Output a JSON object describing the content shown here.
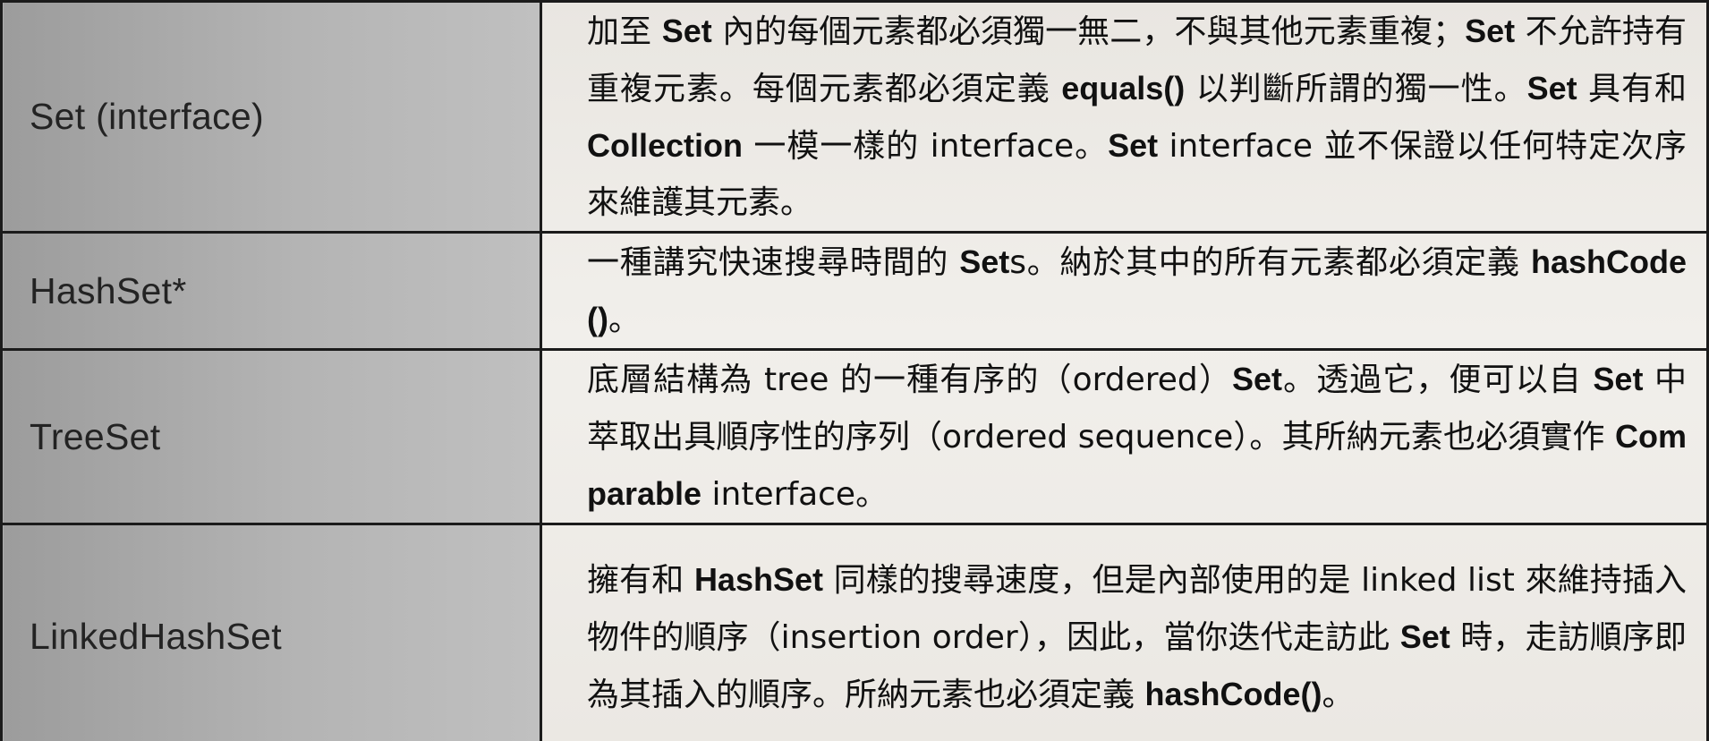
{
  "set_types": [
    {
      "name": "Set (interface)",
      "description": [
        {
          "t": "加至 "
        },
        {
          "t": "Set",
          "b": true
        },
        {
          "t": " 內的每個元素都必須獨一無二，不與其他元素重複；"
        },
        {
          "t": "Set",
          "b": true
        },
        {
          "t": " 不允許持有重複元素。每個元素都必須定義 "
        },
        {
          "t": "equals()",
          "b": true
        },
        {
          "t": " 以判斷所謂的獨一性。"
        },
        {
          "t": "Set",
          "b": true
        },
        {
          "t": " 具有和 "
        },
        {
          "t": "Collection",
          "b": true
        },
        {
          "t": " 一模一樣的 interface。"
        },
        {
          "t": "Set",
          "b": true
        },
        {
          "t": " interface 並不保證以任何特定次序來維護其元素。"
        }
      ]
    },
    {
      "name": "HashSet*",
      "description": [
        {
          "t": "一種講究快速搜尋時間的 "
        },
        {
          "t": "Set",
          "b": true
        },
        {
          "t": "s。納於其中的所有元素都必須定義 "
        },
        {
          "t": "hashCode()",
          "b": true
        },
        {
          "t": "。"
        }
      ]
    },
    {
      "name": "TreeSet",
      "description": [
        {
          "t": "底層結構為 tree 的一種有序的（ordered）"
        },
        {
          "t": "Set",
          "b": true
        },
        {
          "t": "。透過它，便可以自 "
        },
        {
          "t": "Set",
          "b": true
        },
        {
          "t": " 中萃取出具順序性的序列（ordered sequence）。其所納元素也必須實作 "
        },
        {
          "t": "Comparable",
          "b": true
        },
        {
          "t": " interface。"
        }
      ]
    },
    {
      "name": "LinkedHashSet",
      "description": [
        {
          "t": "擁有和 "
        },
        {
          "t": "HashSet",
          "b": true
        },
        {
          "t": " 同樣的搜尋速度，但是內部使用的是 linked list 來維持插入物件的順序（insertion order），因此，當你迭代走訪此 "
        },
        {
          "t": "Set",
          "b": true
        },
        {
          "t": " 時，走訪順序即為其插入的順序。所納元素也必須定義 "
        },
        {
          "t": "hashCode()",
          "b": true
        },
        {
          "t": "。"
        }
      ]
    }
  ]
}
